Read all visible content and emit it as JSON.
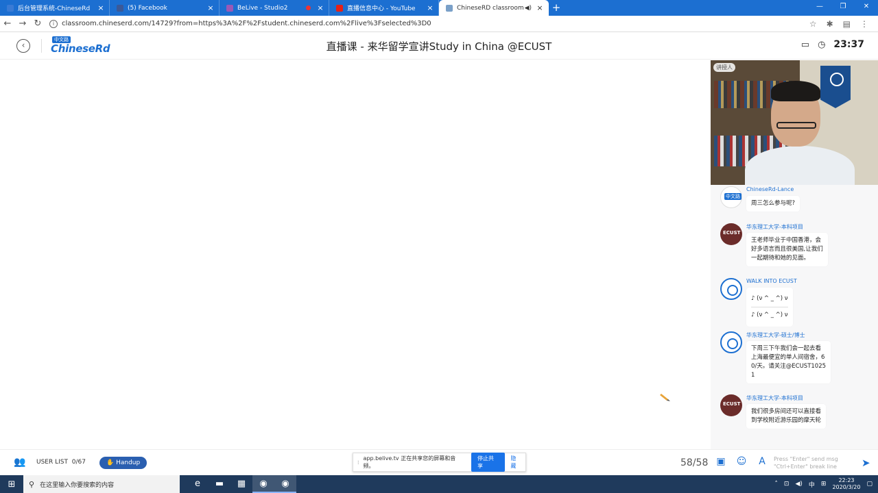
{
  "browser": {
    "tabs": [
      {
        "title": "后台管理系统-ChineseRd",
        "favicon_color": "#3a7bd5",
        "active": false
      },
      {
        "title": "(5) Facebook",
        "favicon_color": "#3b5998",
        "active": false
      },
      {
        "title": "BeLive - Studio2",
        "favicon_color": "#9b59b6",
        "active": false
      },
      {
        "title": "直播信息中心 - YouTube",
        "favicon_color": "#e62117",
        "active": false
      },
      {
        "title": "ChineseRD classroom",
        "favicon_color": "#7aa0c8",
        "active": true
      }
    ],
    "new_tab_label": "+",
    "url": "classroom.chineserd.com/14729?from=https%3A%2F%2Fstudent.chineserd.com%2Flive%3Fselected%3D0"
  },
  "header": {
    "logo_badge": "中文路",
    "logo_text": "ChineseRd",
    "title": "直播课 - 来华留学宣讲Study in China @ECUST",
    "clock": "23:37"
  },
  "video": {
    "tag": "讲授人"
  },
  "chat": {
    "messages": [
      {
        "sender": "ChineseRd-Lance",
        "avatar": "chineserd",
        "lines": [
          "周三怎么参与呢?"
        ]
      },
      {
        "sender": "华东理工大学-本科项目",
        "avatar": "ecust",
        "lines": [
          "王老师毕业于中国香港，会",
          "好多语言而且很美国,让我们",
          "一起期待和她的见面。"
        ]
      },
      {
        "sender": "WALK INTO ECUST",
        "avatar": "walk",
        "lines": [
          "♪ (ν ^ _ ^) ν",
          "♪ (ν ^ _ ^) ν"
        ]
      },
      {
        "sender": "华东理工大学-硕士/博士",
        "avatar": "walk",
        "lines": [
          "下周三下午我们会一起去看",
          "上海最便宜的单人间宿舍，6",
          "0/天。请关注@ECUST1025",
          "1"
        ]
      },
      {
        "sender": "华东理工大学-本科项目",
        "avatar": "ecust",
        "lines": [
          "我们很多房间还可以直接看",
          "到学校附近游乐园的摩天轮"
        ]
      }
    ]
  },
  "bottom": {
    "user_list_label": "USER LIST",
    "user_count": "0/67",
    "handup_label": "Handup",
    "share_notice": "app.belive.tv 正在共享您的屏幕和音频。",
    "stop_share_label": "停止共享",
    "hide_label": "隐藏",
    "page_count": "58/58",
    "input_placeholder_line1": "Press \"Enter\" send msg",
    "input_placeholder_line2": "\"Ctrl+Enter\" break line"
  },
  "taskbar": {
    "search_placeholder": "在这里输入你要搜索的内容",
    "ime": "中",
    "time": "22:23",
    "date": "2020/3/20"
  }
}
